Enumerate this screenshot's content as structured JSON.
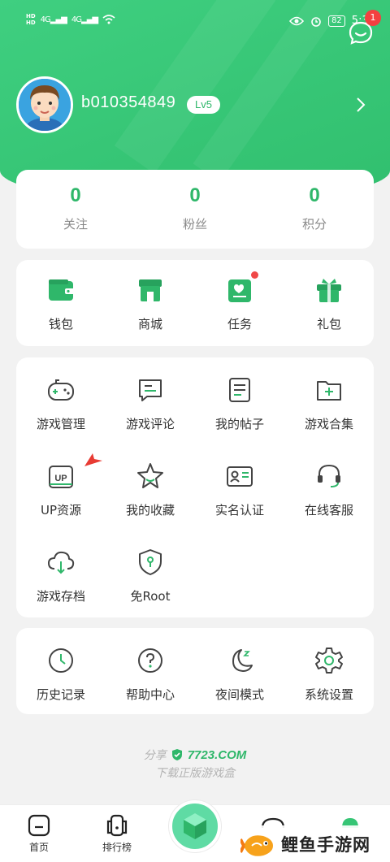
{
  "status_bar": {
    "hd1": "HD",
    "hd2": "HD",
    "signal1": "4G",
    "signal2": "4G",
    "battery": "82",
    "time": "5:34"
  },
  "header": {
    "message_badge": "1"
  },
  "profile": {
    "username": "b010354849",
    "level": "Lv5"
  },
  "stats": [
    {
      "value": "0",
      "label": "关注"
    },
    {
      "value": "0",
      "label": "粉丝"
    },
    {
      "value": "0",
      "label": "积分"
    }
  ],
  "quick_actions": [
    {
      "label": "钱包"
    },
    {
      "label": "商城"
    },
    {
      "label": "任务"
    },
    {
      "label": "礼包"
    }
  ],
  "tools": [
    {
      "label": "游戏管理"
    },
    {
      "label": "游戏评论"
    },
    {
      "label": "我的帖子"
    },
    {
      "label": "游戏合集"
    },
    {
      "label": "UP资源"
    },
    {
      "label": "我的收藏"
    },
    {
      "label": "实名认证"
    },
    {
      "label": "在线客服"
    },
    {
      "label": "游戏存档"
    },
    {
      "label": "免Root"
    }
  ],
  "settings_items": [
    {
      "label": "历史记录"
    },
    {
      "label": "帮助中心"
    },
    {
      "label": "夜间模式"
    },
    {
      "label": "系统设置"
    }
  ],
  "share": {
    "prefix": "分享",
    "brand": "7723.COM",
    "subtitle": "下载正版游戏盒"
  },
  "bottom_nav": [
    {
      "label": "首页"
    },
    {
      "label": "排行榜"
    }
  ],
  "watermark": {
    "text": "鲤鱼手游网"
  },
  "colors": {
    "accent": "#2fb76a",
    "header": "#36c575",
    "badge": "#f34040"
  }
}
